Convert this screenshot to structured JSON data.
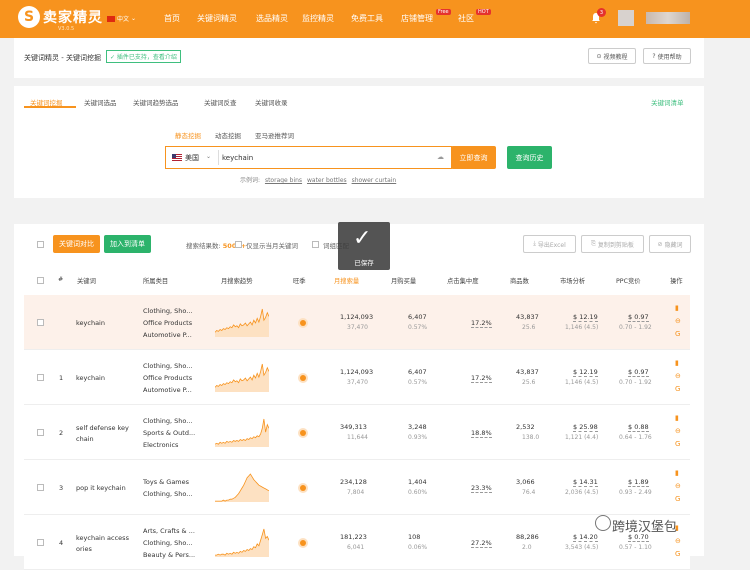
{
  "colors": {
    "brand": "#f7931e",
    "green": "#2cb36b",
    "badge": "#e5322d"
  },
  "header": {
    "logo_text": "卖家精灵",
    "version": "V3.0.5",
    "lang": "中文",
    "nav": [
      "首页",
      "关键词精灵",
      "选品精灵",
      "监控精灵",
      "免费工具",
      "店铺管理",
      "社区"
    ],
    "badge_free": "Free",
    "badge_hot": "HOT",
    "notification_count": "3"
  },
  "page": {
    "breadcrumb": "关键词精灵 - 关键词挖掘",
    "plugin_tag": "✓ 插件已支持，查看介绍",
    "video_btn": "视频教程",
    "help_btn": "使用帮助"
  },
  "tabs": [
    "关键词挖掘",
    "关键词选品",
    "关键词趋势选品",
    "关键词反查",
    "关键词收录"
  ],
  "keyword_list_link": "关键词清单",
  "search": {
    "modes": [
      "静态挖掘",
      "动态挖掘",
      "亚马逊推荐词"
    ],
    "country": "美国",
    "value": "keychain",
    "submit": "立即查询",
    "history": "查询历史",
    "examples_label": "示例词:",
    "examples": [
      "storage bins",
      "water bottles",
      "shower curtain"
    ]
  },
  "toolbar": {
    "compare_btn": "关键词对比",
    "add_list_btn": "加入到清单",
    "result_label": "搜索结果数:",
    "result_count": "5000+",
    "filter1": "仅显示当月关键词",
    "filter2": "词组匹配",
    "export_btn": "导出Excel",
    "copy_btn": "复制到剪贴板",
    "hide_btn": "隐藏词"
  },
  "toast": {
    "message": "已保存"
  },
  "table": {
    "headers": [
      "#",
      "关键词",
      "所属类目",
      "月搜索趋势",
      "旺季",
      "月搜索量",
      "月购买量",
      "点击集中度",
      "商品数",
      "市场分析",
      "PPC竞价",
      "操作"
    ],
    "rows": [
      {
        "num": "",
        "keyword": [
          "keychain"
        ],
        "categories": [
          "Clothing, Sho...",
          "Office Products",
          "Automotive P..."
        ],
        "searches": "1,124,093",
        "searches_sub": "37,470",
        "purchases": "6,407",
        "purchases_rate": "0.57%",
        "click_conc": "17.2%",
        "products": "43,837",
        "products_sub": "25.6",
        "market_price": "$ 12.19",
        "market_sub": "1,146 (4.5)",
        "ppc": "$ 0.97",
        "ppc_range": "0.70 - 1.92",
        "trend": [
          5,
          7,
          6,
          8,
          7,
          9,
          8,
          10,
          9,
          11,
          10,
          13,
          11,
          12,
          10,
          14,
          12,
          13,
          15,
          12,
          14,
          16,
          13,
          18,
          15,
          20,
          16,
          22,
          30,
          18,
          21,
          26,
          22
        ],
        "highlight": true
      },
      {
        "num": "1",
        "keyword": [
          "keychain"
        ],
        "categories": [
          "Clothing, Sho...",
          "Office Products",
          "Automotive P..."
        ],
        "searches": "1,124,093",
        "searches_sub": "37,470",
        "purchases": "6,407",
        "purchases_rate": "0.57%",
        "click_conc": "17.2%",
        "products": "43,837",
        "products_sub": "25.6",
        "market_price": "$ 12.19",
        "market_sub": "1,146 (4.5)",
        "ppc": "$ 0.97",
        "ppc_range": "0.70 - 1.92",
        "trend": [
          5,
          7,
          6,
          8,
          7,
          9,
          8,
          10,
          9,
          11,
          10,
          13,
          11,
          12,
          10,
          14,
          12,
          13,
          15,
          12,
          14,
          16,
          13,
          18,
          15,
          20,
          16,
          22,
          30,
          18,
          21,
          26,
          22
        ],
        "highlight": false
      },
      {
        "num": "2",
        "keyword": [
          "self defense key",
          "chain"
        ],
        "categories": [
          "Clothing, Sho...",
          "Sports & Outd...",
          "Electronics"
        ],
        "searches": "349,313",
        "searches_sub": "11,644",
        "purchases": "3,248",
        "purchases_rate": "0.93%",
        "click_conc": "18.8%",
        "products": "2,532",
        "products_sub": "138.0",
        "market_price": "$ 25.98",
        "market_sub": "1,121 (4.4)",
        "ppc": "$ 0.88",
        "ppc_range": "0.64 - 1.76",
        "trend": [
          3,
          4,
          3,
          5,
          4,
          5,
          4,
          6,
          5,
          6,
          5,
          7,
          6,
          7,
          6,
          8,
          7,
          8,
          7,
          9,
          8,
          10,
          9,
          11,
          10,
          12,
          11,
          14,
          20,
          30,
          16,
          24,
          20
        ],
        "highlight": false
      },
      {
        "num": "3",
        "keyword": [
          "pop it keychain"
        ],
        "categories": [
          "Toys & Games",
          "Clothing, Sho..."
        ],
        "searches": "234,128",
        "searches_sub": "7,804",
        "purchases": "1,404",
        "purchases_rate": "0.60%",
        "click_conc": "23.3%",
        "products": "3,066",
        "products_sub": "76.4",
        "market_price": "$ 14.31",
        "market_sub": "2,036 (4.5)",
        "ppc": "$ 1.89",
        "ppc_range": "0.93 - 2.49",
        "trend": [
          1,
          1,
          1,
          1,
          1,
          2,
          1,
          2,
          2,
          3,
          3,
          4,
          5,
          7,
          9,
          12,
          15,
          18,
          22,
          26,
          28,
          30,
          27,
          24,
          22,
          20,
          18,
          17,
          16,
          15,
          14,
          13,
          12
        ],
        "highlight": false
      },
      {
        "num": "4",
        "keyword": [
          "keychain access",
          "ories"
        ],
        "categories": [
          "Arts, Crafts & ...",
          "Clothing, Sho...",
          "Beauty & Pers..."
        ],
        "searches": "181,223",
        "searches_sub": "6,041",
        "purchases": "108",
        "purchases_rate": "0.06%",
        "click_conc": "27.2%",
        "products": "88,286",
        "products_sub": "2.0",
        "market_price": "$ 14.20",
        "market_sub": "3,543 (4.5)",
        "ppc": "$ 0.70",
        "ppc_range": "0.57 - 1.10",
        "trend": [
          2,
          2,
          3,
          2,
          3,
          3,
          2,
          4,
          3,
          4,
          3,
          5,
          4,
          5,
          4,
          6,
          5,
          7,
          6,
          8,
          7,
          9,
          8,
          11,
          10,
          14,
          12,
          18,
          24,
          30,
          20,
          22,
          18
        ],
        "highlight": false
      }
    ]
  },
  "watermark": "跨境汉堡包"
}
